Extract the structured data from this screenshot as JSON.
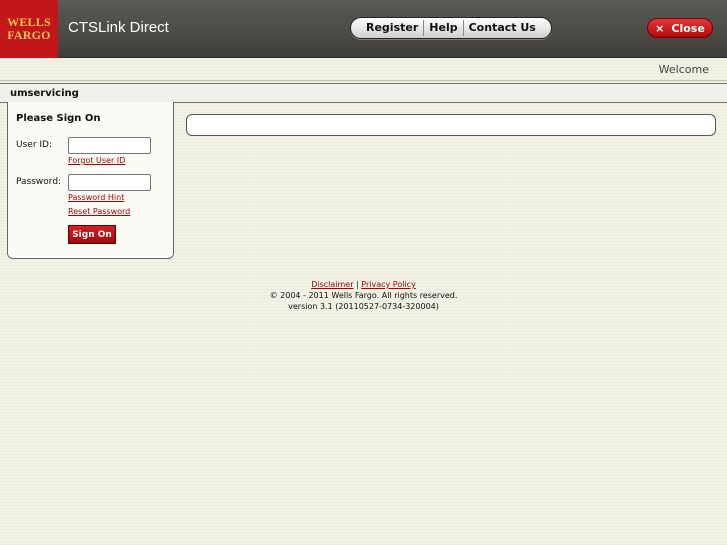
{
  "header": {
    "logo_line1": "WELLS",
    "logo_line2": "FARGO",
    "app_title": "CTSLink Direct",
    "nav": [
      "Register",
      "Help",
      "Contact Us"
    ],
    "close_label": "Close",
    "close_glyph": "×"
  },
  "welcome_text": "Welcome",
  "user_bar": {
    "username": "umservicing"
  },
  "signon": {
    "title": "Please Sign On",
    "user_id_label": "User ID:",
    "user_id_value": "",
    "forgot_user_id": "Forgot User ID",
    "password_label": "Password:",
    "password_value": "",
    "password_hint": "Password Hint",
    "reset_password": "Reset Password",
    "button": "Sign On"
  },
  "footer": {
    "disclaimer": "Disclaimer",
    "separator": " | ",
    "privacy": "Privacy Policy",
    "copyright": "© 2004 - 2011 Wells Fargo. All rights reserved.",
    "version": "version 3.1 (20110527-0734-320004)"
  },
  "colors": {
    "brand_red": "#c2161b",
    "logo_gold": "#f2c84b",
    "header_dark": "#4a4944",
    "link_red": "#aa0000"
  }
}
